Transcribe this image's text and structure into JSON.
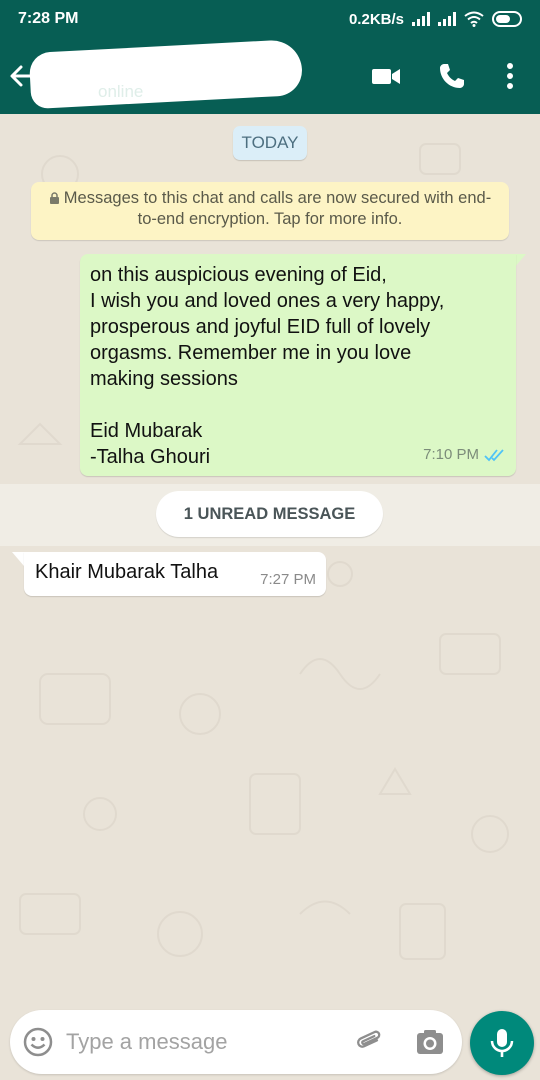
{
  "status_bar": {
    "time": "7:28 PM",
    "network_speed": "0.2KB/s"
  },
  "header": {
    "contact_status": "online",
    "icons": [
      "back-arrow-icon",
      "video-call-icon",
      "phone-call-icon",
      "more-vert-icon"
    ]
  },
  "chat": {
    "date_label": "TODAY",
    "encryption_notice": "Messages to this chat and calls are now secured with end-to-end encryption. Tap for more info.",
    "outgoing_message": {
      "lines": [
        "on this auspicious evening of Eid,",
        "I wish you and loved ones a very happy,",
        "prosperous and joyful EID full of lovely",
        "orgasms. Remember me in you love",
        "making sessions",
        "",
        "Eid Mubarak",
        "-Talha Ghouri"
      ],
      "time": "7:10 PM",
      "status": "read"
    },
    "unread_label": "1 UNREAD MESSAGE",
    "incoming_message": {
      "text": "Khair Mubarak Talha",
      "time": "7:27 PM"
    }
  },
  "composer": {
    "placeholder": "Type a message",
    "value": ""
  },
  "colors": {
    "header": "#075e54",
    "outgoing_bubble": "#dcf8c6",
    "incoming_bubble": "#ffffff",
    "notice": "#fdf4c5",
    "date_pill": "#dbeef8",
    "read_ticks": "#4fc3f7",
    "mic_button": "#00897b",
    "chat_background": "#e9e3d8"
  }
}
